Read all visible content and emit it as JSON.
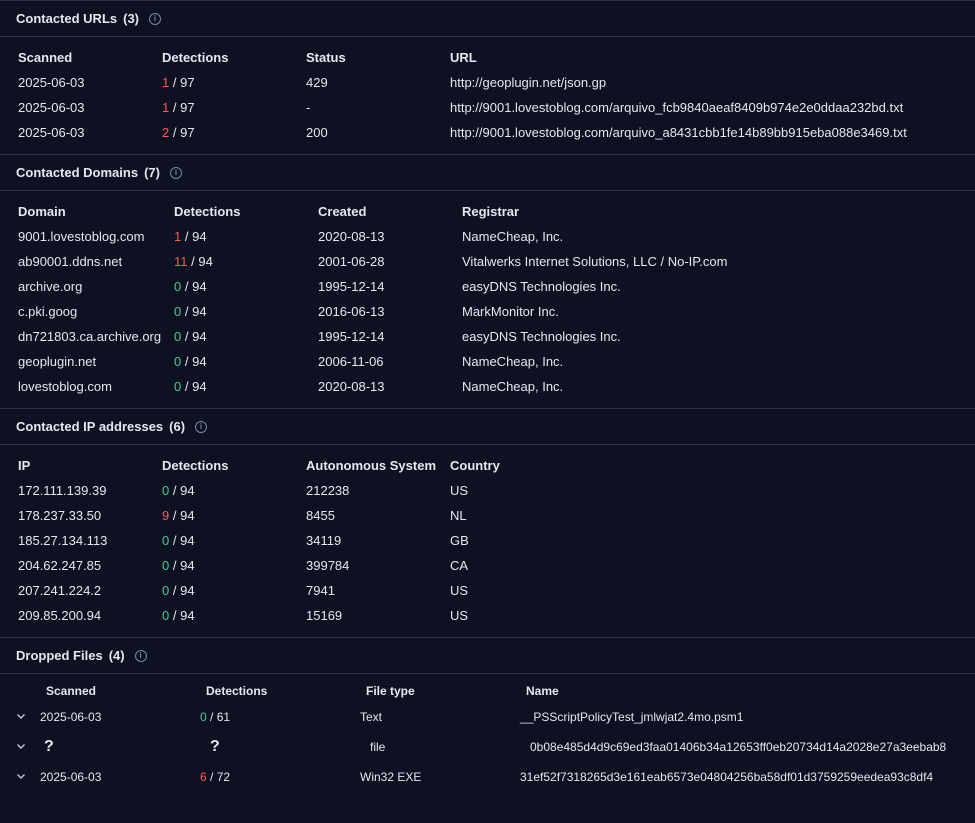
{
  "contacted_urls": {
    "title": "Contacted URLs",
    "count": "(3)",
    "headers": [
      "Scanned",
      "Detections",
      "Status",
      "URL"
    ],
    "rows": [
      {
        "scanned": "2025-06-03",
        "det": "1",
        "total": "/ 97",
        "status": "429",
        "url": "http://geoplugin.net/json.gp"
      },
      {
        "scanned": "2025-06-03",
        "det": "1",
        "total": "/ 97",
        "status": "-",
        "url": "http://9001.lovestoblog.com/arquivo_fcb9840aeaf8409b974e2e0ddaa232bd.txt"
      },
      {
        "scanned": "2025-06-03",
        "det": "2",
        "total": "/ 97",
        "status": "200",
        "url": "http://9001.lovestoblog.com/arquivo_a8431cbb1fe14b89bb915eba088e3469.txt"
      }
    ]
  },
  "contacted_domains": {
    "title": "Contacted Domains",
    "count": "(7)",
    "headers": [
      "Domain",
      "Detections",
      "Created",
      "Registrar"
    ],
    "rows": [
      {
        "domain": "9001.lovestoblog.com",
        "det": "1",
        "total": "/ 94",
        "created": "2020-08-13",
        "registrar": "NameCheap, Inc."
      },
      {
        "domain": "ab90001.ddns.net",
        "det": "11",
        "total": "/ 94",
        "created": "2001-06-28",
        "registrar": "Vitalwerks Internet Solutions, LLC / No-IP.com"
      },
      {
        "domain": "archive.org",
        "det": "0",
        "total": "/ 94",
        "created": "1995-12-14",
        "registrar": "easyDNS Technologies Inc."
      },
      {
        "domain": "c.pki.goog",
        "det": "0",
        "total": "/ 94",
        "created": "2016-06-13",
        "registrar": "MarkMonitor Inc."
      },
      {
        "domain": "dn721803.ca.archive.org",
        "det": "0",
        "total": "/ 94",
        "created": "1995-12-14",
        "registrar": "easyDNS Technologies Inc."
      },
      {
        "domain": "geoplugin.net",
        "det": "0",
        "total": "/ 94",
        "created": "2006-11-06",
        "registrar": "NameCheap, Inc."
      },
      {
        "domain": "lovestoblog.com",
        "det": "0",
        "total": "/ 94",
        "created": "2020-08-13",
        "registrar": "NameCheap, Inc."
      }
    ]
  },
  "contacted_ips": {
    "title": "Contacted IP addresses",
    "count": "(6)",
    "headers": [
      "IP",
      "Detections",
      "Autonomous System",
      "Country"
    ],
    "rows": [
      {
        "ip": "172.111.139.39",
        "det": "0",
        "total": "/ 94",
        "as": "212238",
        "country": "US"
      },
      {
        "ip": "178.237.33.50",
        "det": "9",
        "total": "/ 94",
        "as": "8455",
        "country": "NL"
      },
      {
        "ip": "185.27.134.113",
        "det": "0",
        "total": "/ 94",
        "as": "34119",
        "country": "GB"
      },
      {
        "ip": "204.62.247.85",
        "det": "0",
        "total": "/ 94",
        "as": "399784",
        "country": "CA"
      },
      {
        "ip": "207.241.224.2",
        "det": "0",
        "total": "/ 94",
        "as": "7941",
        "country": "US"
      },
      {
        "ip": "209.85.200.94",
        "det": "0",
        "total": "/ 94",
        "as": "15169",
        "country": "US"
      }
    ]
  },
  "dropped_files": {
    "title": "Dropped Files",
    "count": "(4)",
    "headers": [
      "Scanned",
      "Detections",
      "File type",
      "Name"
    ],
    "rows": [
      {
        "scanned": "2025-06-03",
        "det": "0",
        "total": "/ 61",
        "type": "Text",
        "name": "__PSScriptPolicyTest_jmlwjat2.4mo.psm1"
      },
      {
        "scanned": "?",
        "det": "?",
        "total": "",
        "type": "file",
        "name": "0b08e485d4d9c69ed3faa01406b34a12653ff0eb20734d14a2028e27a3eebab8"
      },
      {
        "scanned": "2025-06-03",
        "det": "6",
        "total": "/ 72",
        "type": "Win32 EXE",
        "name": "31ef52f7318265d3e161eab6573e04804256ba58df01d3759259eedea93c8df4"
      }
    ]
  },
  "colors": {
    "malicious": "#ff5a50",
    "clean": "#3ecf8e",
    "background": "#0d1121"
  },
  "icons": {
    "info": "info-icon",
    "expand": "chevron-down-icon"
  }
}
